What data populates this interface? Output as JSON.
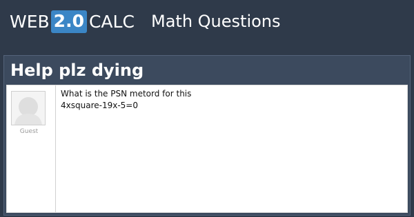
{
  "header": {
    "logo": {
      "part1": "WEB",
      "badge": "2.0",
      "part2": "CALC"
    },
    "section": "Math Questions"
  },
  "question": {
    "title": "Help plz dying",
    "author": "Guest",
    "body_lines": [
      "What is the PSN metord for this",
      "4xsquare-19x-5=0"
    ]
  },
  "colors": {
    "background": "#2f3a4a",
    "panel": "#3c4a5e",
    "badge": "#3b86c6"
  },
  "icons": {
    "avatar": "default-user-avatar-icon"
  }
}
